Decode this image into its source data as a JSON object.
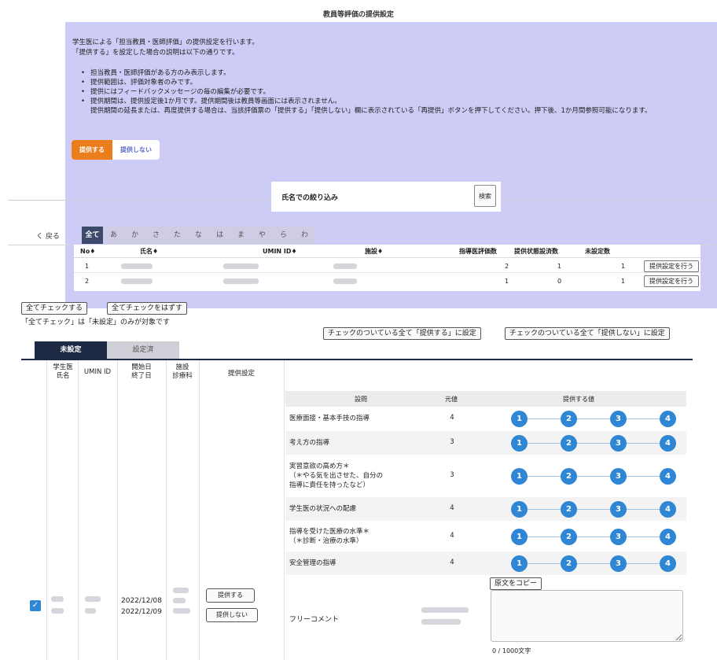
{
  "page_title": "教員等評価の提供設定",
  "intro": {
    "line1": "学生医による「担当教員・医師評価」の提供設定を行います。",
    "line2": "「提供する」を設定した場合の説明は以下の通りです。",
    "bullets": [
      "担当教員・医師評価がある方のみ表示します。",
      "提供範囲は、評価対象者のみです。",
      "提供にはフィードバックメッセージの毎の編集が必要です。",
      "提供期間は、提供設定後1か月です。提供期間後は教員等画面には表示されません。"
    ],
    "bullet_cont": "提供期間の延長または、再度提供する場合は、当該評価票の「提供する」「提供しない」欄に表示されている「再提供」ボタンを押下してください。押下後、1か月間参照可能になります。"
  },
  "toggle": {
    "on": "提供する",
    "off": "提供しない"
  },
  "filter": {
    "label": "氏名での絞り込み",
    "placeholder": "",
    "search_label": "検索"
  },
  "back_label": "く 戻る",
  "kana_tabs": [
    "全て",
    "あ",
    "か",
    "さ",
    "た",
    "な",
    "は",
    "ま",
    "や",
    "ら",
    "わ"
  ],
  "list": {
    "headers": {
      "no": "No♦",
      "name": "氏名♦",
      "umin": "UMIN ID♦",
      "facility": "施設♦",
      "eval_count": "指導医評価数",
      "status_count": "提供状態設済数",
      "unset_count": "未設定数"
    },
    "rows": [
      {
        "no": "1",
        "eval_count": "2",
        "status_count": "1",
        "unset_count": "1",
        "action": "提供設定を行う"
      },
      {
        "no": "2",
        "eval_count": "1",
        "status_count": "0",
        "unset_count": "1",
        "action": "提供設定を行う"
      }
    ]
  },
  "bulk": {
    "check_all": "全てチェックする",
    "uncheck_all": "全てチェックをはずす",
    "note": "「全てチェック」は「未設定」のみが対象です",
    "set_provide": "チェックのついている全て「提供する」に設定",
    "set_not_provide": "チェックのついている全て「提供しない」に設定"
  },
  "status_tabs": {
    "unset": "未設定",
    "set": "設定済"
  },
  "detail_headers": {
    "student": "学生医\n氏名",
    "umin": "UMIN ID",
    "dates": "開始日\n終了日",
    "facility": "施設\n診療科",
    "setting": "提供設定"
  },
  "question_headers": {
    "question": "設問",
    "orig": "元値",
    "provide": "提供する値"
  },
  "questions": [
    {
      "text": "医療面接・基本手技の指導",
      "value": "4"
    },
    {
      "text": "考え方の指導",
      "value": "3"
    },
    {
      "text": "実習意欲の高め方＊\n（＊やる気を出させた、自分の\n指導に責任を持ったなど）",
      "value": "3"
    },
    {
      "text": "学生医の状況への配慮",
      "value": "4"
    },
    {
      "text": "指導を受けた医療の水準＊\n（＊診断・治療の水準）",
      "value": "4"
    },
    {
      "text": "安全管理の指導",
      "value": "4"
    }
  ],
  "scale": [
    "1",
    "2",
    "3",
    "4"
  ],
  "record": {
    "start_date": "2022/12/08",
    "end_date": "2022/12/09",
    "provide_btn": "提供する",
    "not_provide_btn": "提供しない",
    "checkmark": "✓"
  },
  "free_comment": {
    "label": "フリーコメント",
    "copy_btn": "原文をコピー",
    "counter": "0 / 1000文字"
  }
}
